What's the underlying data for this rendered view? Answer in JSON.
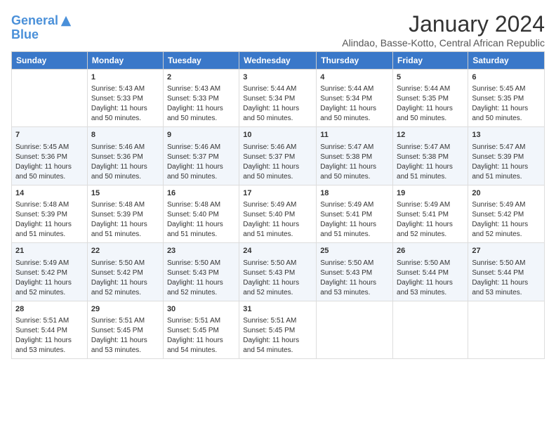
{
  "header": {
    "logo_line1": "General",
    "logo_line2": "Blue",
    "month": "January 2024",
    "location": "Alindao, Basse-Kotto, Central African Republic"
  },
  "days_of_week": [
    "Sunday",
    "Monday",
    "Tuesday",
    "Wednesday",
    "Thursday",
    "Friday",
    "Saturday"
  ],
  "weeks": [
    [
      {
        "day": "",
        "content": ""
      },
      {
        "day": "1",
        "content": "Sunrise: 5:43 AM\nSunset: 5:33 PM\nDaylight: 11 hours\nand 50 minutes."
      },
      {
        "day": "2",
        "content": "Sunrise: 5:43 AM\nSunset: 5:33 PM\nDaylight: 11 hours\nand 50 minutes."
      },
      {
        "day": "3",
        "content": "Sunrise: 5:44 AM\nSunset: 5:34 PM\nDaylight: 11 hours\nand 50 minutes."
      },
      {
        "day": "4",
        "content": "Sunrise: 5:44 AM\nSunset: 5:34 PM\nDaylight: 11 hours\nand 50 minutes."
      },
      {
        "day": "5",
        "content": "Sunrise: 5:44 AM\nSunset: 5:35 PM\nDaylight: 11 hours\nand 50 minutes."
      },
      {
        "day": "6",
        "content": "Sunrise: 5:45 AM\nSunset: 5:35 PM\nDaylight: 11 hours\nand 50 minutes."
      }
    ],
    [
      {
        "day": "7",
        "content": "Sunrise: 5:45 AM\nSunset: 5:36 PM\nDaylight: 11 hours\nand 50 minutes."
      },
      {
        "day": "8",
        "content": "Sunrise: 5:46 AM\nSunset: 5:36 PM\nDaylight: 11 hours\nand 50 minutes."
      },
      {
        "day": "9",
        "content": "Sunrise: 5:46 AM\nSunset: 5:37 PM\nDaylight: 11 hours\nand 50 minutes."
      },
      {
        "day": "10",
        "content": "Sunrise: 5:46 AM\nSunset: 5:37 PM\nDaylight: 11 hours\nand 50 minutes."
      },
      {
        "day": "11",
        "content": "Sunrise: 5:47 AM\nSunset: 5:38 PM\nDaylight: 11 hours\nand 50 minutes."
      },
      {
        "day": "12",
        "content": "Sunrise: 5:47 AM\nSunset: 5:38 PM\nDaylight: 11 hours\nand 51 minutes."
      },
      {
        "day": "13",
        "content": "Sunrise: 5:47 AM\nSunset: 5:39 PM\nDaylight: 11 hours\nand 51 minutes."
      }
    ],
    [
      {
        "day": "14",
        "content": "Sunrise: 5:48 AM\nSunset: 5:39 PM\nDaylight: 11 hours\nand 51 minutes."
      },
      {
        "day": "15",
        "content": "Sunrise: 5:48 AM\nSunset: 5:39 PM\nDaylight: 11 hours\nand 51 minutes."
      },
      {
        "day": "16",
        "content": "Sunrise: 5:48 AM\nSunset: 5:40 PM\nDaylight: 11 hours\nand 51 minutes."
      },
      {
        "day": "17",
        "content": "Sunrise: 5:49 AM\nSunset: 5:40 PM\nDaylight: 11 hours\nand 51 minutes."
      },
      {
        "day": "18",
        "content": "Sunrise: 5:49 AM\nSunset: 5:41 PM\nDaylight: 11 hours\nand 51 minutes."
      },
      {
        "day": "19",
        "content": "Sunrise: 5:49 AM\nSunset: 5:41 PM\nDaylight: 11 hours\nand 52 minutes."
      },
      {
        "day": "20",
        "content": "Sunrise: 5:49 AM\nSunset: 5:42 PM\nDaylight: 11 hours\nand 52 minutes."
      }
    ],
    [
      {
        "day": "21",
        "content": "Sunrise: 5:49 AM\nSunset: 5:42 PM\nDaylight: 11 hours\nand 52 minutes."
      },
      {
        "day": "22",
        "content": "Sunrise: 5:50 AM\nSunset: 5:42 PM\nDaylight: 11 hours\nand 52 minutes."
      },
      {
        "day": "23",
        "content": "Sunrise: 5:50 AM\nSunset: 5:43 PM\nDaylight: 11 hours\nand 52 minutes."
      },
      {
        "day": "24",
        "content": "Sunrise: 5:50 AM\nSunset: 5:43 PM\nDaylight: 11 hours\nand 52 minutes."
      },
      {
        "day": "25",
        "content": "Sunrise: 5:50 AM\nSunset: 5:43 PM\nDaylight: 11 hours\nand 53 minutes."
      },
      {
        "day": "26",
        "content": "Sunrise: 5:50 AM\nSunset: 5:44 PM\nDaylight: 11 hours\nand 53 minutes."
      },
      {
        "day": "27",
        "content": "Sunrise: 5:50 AM\nSunset: 5:44 PM\nDaylight: 11 hours\nand 53 minutes."
      }
    ],
    [
      {
        "day": "28",
        "content": "Sunrise: 5:51 AM\nSunset: 5:44 PM\nDaylight: 11 hours\nand 53 minutes."
      },
      {
        "day": "29",
        "content": "Sunrise: 5:51 AM\nSunset: 5:45 PM\nDaylight: 11 hours\nand 53 minutes."
      },
      {
        "day": "30",
        "content": "Sunrise: 5:51 AM\nSunset: 5:45 PM\nDaylight: 11 hours\nand 54 minutes."
      },
      {
        "day": "31",
        "content": "Sunrise: 5:51 AM\nSunset: 5:45 PM\nDaylight: 11 hours\nand 54 minutes."
      },
      {
        "day": "",
        "content": ""
      },
      {
        "day": "",
        "content": ""
      },
      {
        "day": "",
        "content": ""
      }
    ]
  ]
}
